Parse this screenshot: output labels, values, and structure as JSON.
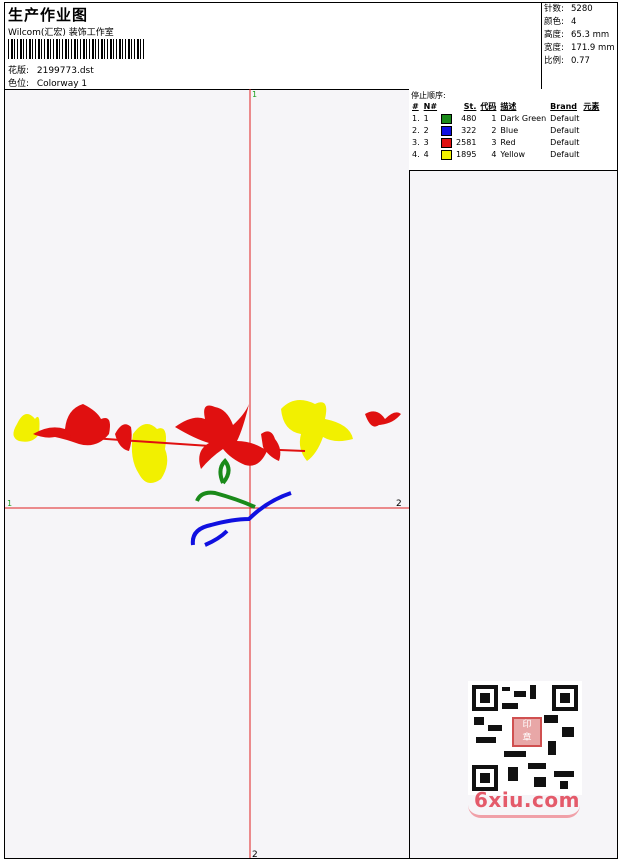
{
  "header": {
    "title": "生产作业图",
    "company": "Wilcom(汇宏) 装饰工作室",
    "design_label": "花版:",
    "design_file": "2199773.dst",
    "colorway_label": "色位:",
    "colorway": "Colorway 1"
  },
  "stats": [
    {
      "label": "针数:",
      "value": "5280"
    },
    {
      "label": "颜色:",
      "value": "4"
    },
    {
      "label": "高度:",
      "value": "65.3 mm"
    },
    {
      "label": "宽度:",
      "value": "171.9 mm"
    },
    {
      "label": "比例:",
      "value": "0.77"
    }
  ],
  "axis_markers": {
    "top": "1",
    "left": "1",
    "right": "2",
    "bottom": "2"
  },
  "legend": {
    "caption": "停止顺序:",
    "headers": [
      "#",
      "N#",
      "St.",
      "代码",
      "描述",
      "Brand",
      "元素"
    ],
    "rows": [
      {
        "num": "1.",
        "n": "1",
        "color": "#1a8a1a",
        "stitches": "480",
        "code": "1",
        "desc": "Dark Green",
        "brand": "Default"
      },
      {
        "num": "2.",
        "n": "2",
        "color": "#1010e0",
        "stitches": "322",
        "code": "2",
        "desc": "Blue",
        "brand": "Default"
      },
      {
        "num": "3.",
        "n": "3",
        "color": "#e01010",
        "stitches": "2581",
        "code": "3",
        "desc": "Red",
        "brand": "Default"
      },
      {
        "num": "4.",
        "n": "4",
        "color": "#f0f000",
        "stitches": "1895",
        "code": "4",
        "desc": "Yellow",
        "brand": "Default"
      }
    ]
  },
  "watermark": {
    "text": "6xiu.com",
    "stamp": "印章"
  },
  "colors": {
    "axis": "#e02020",
    "marker": "#20a020"
  }
}
